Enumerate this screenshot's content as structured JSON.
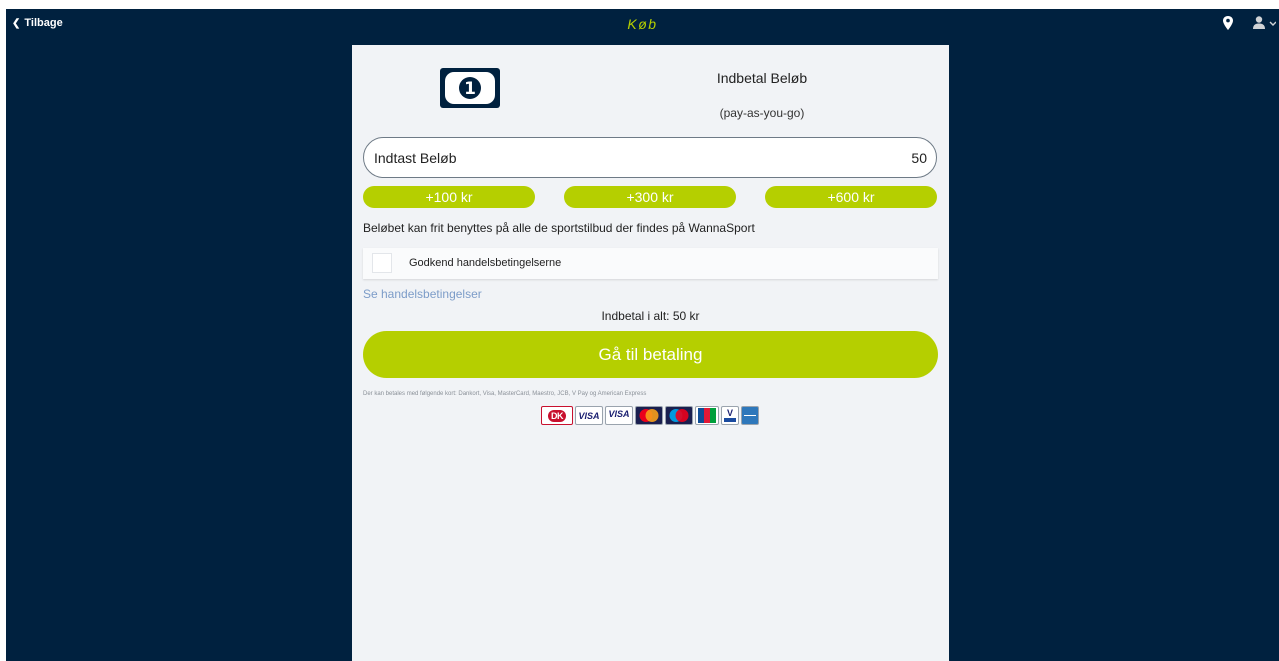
{
  "header": {
    "back_label": "Tilbage",
    "title": "Køb"
  },
  "product": {
    "title": "Indbetal Beløb",
    "subtitle": "(pay-as-you-go)"
  },
  "amount_field": {
    "label": "Indtast Beløb",
    "value": "50"
  },
  "quick_amounts": [
    "+100 kr",
    "+300 kr",
    "+600 kr"
  ],
  "description": "Beløbet kan frit benyttes på alle de sportstilbud der findes på WannaSport",
  "terms": {
    "checkbox_label": "Godkend handelsbetingelserne",
    "checked": false,
    "link": "Se handelsbetingelser"
  },
  "total": "Indbetal i alt: 50 kr",
  "pay_button": "Gå til betaling",
  "cards_note": "Der kan betales med følgende kort: Dankort, Visa, MasterCard, Maestro, JCB, V Pay og American Express",
  "cards": [
    "Dankort",
    "Visa",
    "Visa Electron",
    "MasterCard",
    "Maestro",
    "JCB",
    "V Pay",
    "American Express"
  ],
  "colors": {
    "navy": "#00213f",
    "accent": "#b5cf00",
    "panel": "#f1f3f6",
    "link": "#7c9cc8"
  }
}
